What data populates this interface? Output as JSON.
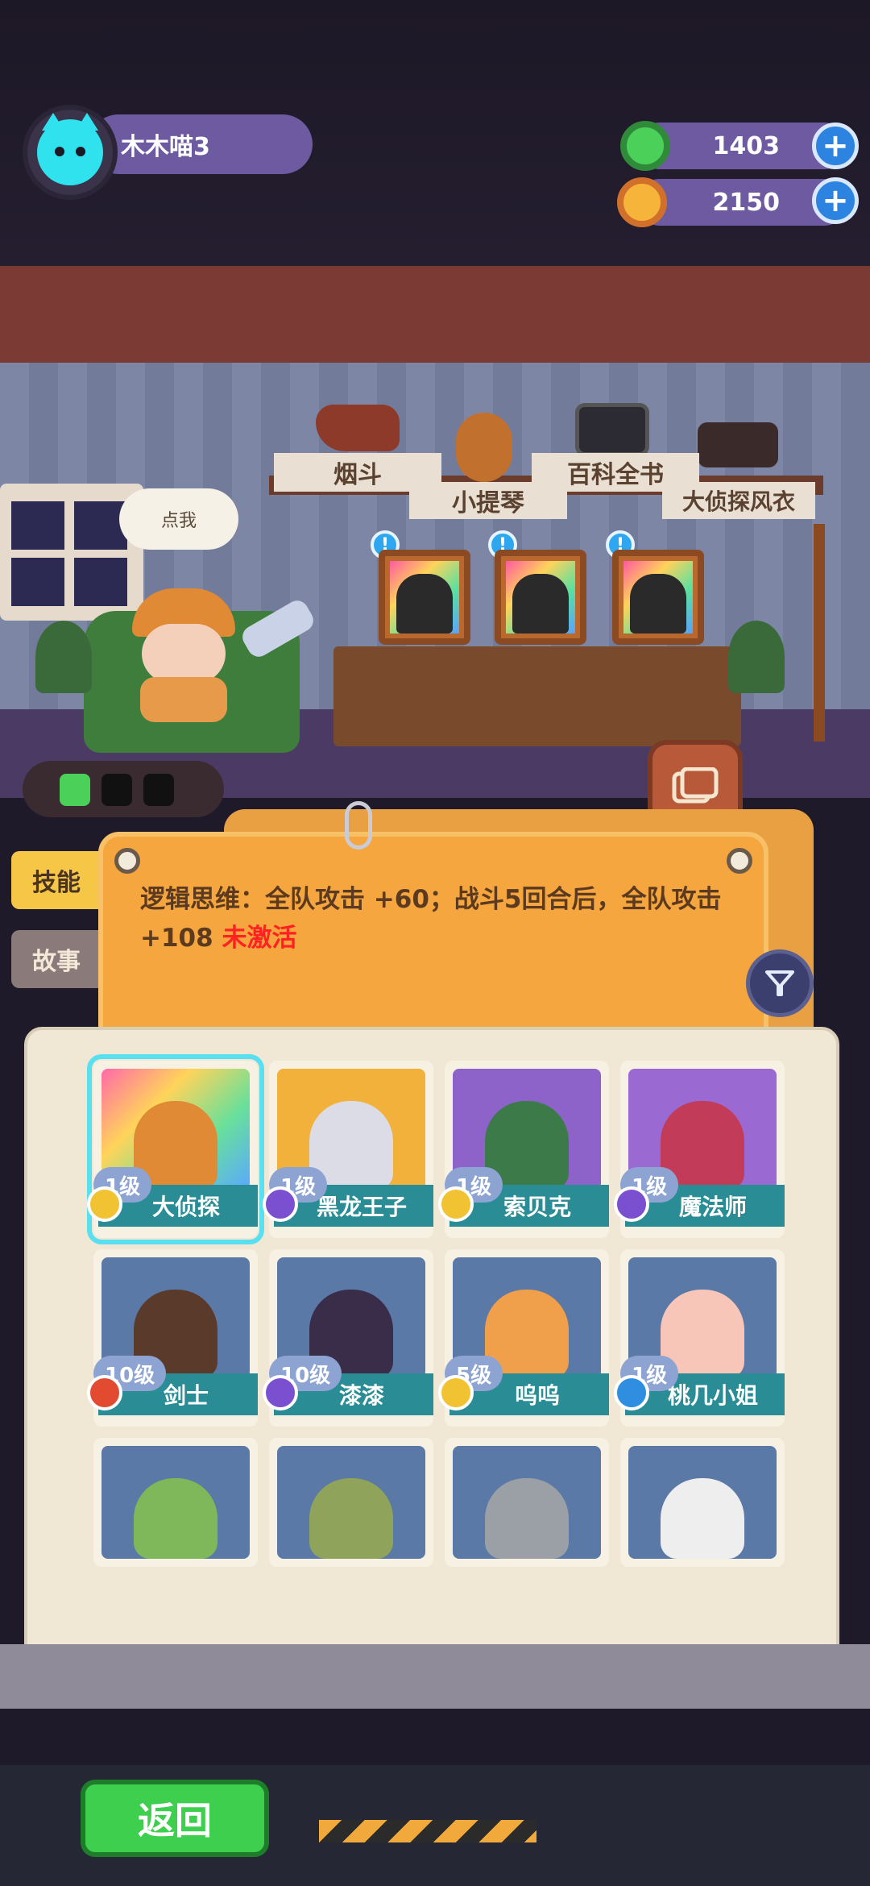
{
  "player": {
    "name": "木木喵3"
  },
  "resources": [
    {
      "icon": "donut-icon",
      "value": "1403",
      "color": "#4bd05a"
    },
    {
      "icon": "planet-coin-icon",
      "value": "2150",
      "color": "#f6b43a"
    }
  ],
  "scene": {
    "bubble": "点我",
    "relics": [
      "烟斗",
      "小提琴",
      "百科全书",
      "大侦探风衣"
    ]
  },
  "tabs": {
    "skill": "技能",
    "story": "故事"
  },
  "skill": {
    "text": "逻辑思维：全队攻击 +60；战斗5回合后，全队攻击 +108 ",
    "status": "未激活"
  },
  "characters": [
    {
      "level": "1级",
      "name": "大侦探",
      "badge_color": "#f1c232",
      "bg": "linear-gradient(135deg,#ff6aa8,#ffd45a,#69e09a,#5aa8ff)",
      "head": "#e08a35",
      "selected": true
    },
    {
      "level": "1级",
      "name": "黑龙王子",
      "badge_color": "#7a4fd0",
      "bg": "#f2b13a",
      "head": "#dcdce6",
      "selected": false
    },
    {
      "level": "1级",
      "name": "索贝克",
      "badge_color": "#f1c232",
      "bg": "#8d63c9",
      "head": "#3c7a4a",
      "selected": false
    },
    {
      "level": "1级",
      "name": "魔法师",
      "badge_color": "#7a4fd0",
      "bg": "#9a6ad2",
      "head": "#c23b58",
      "selected": false
    },
    {
      "level": "10级",
      "name": "剑士",
      "badge_color": "#e24b2f",
      "bg": "#5b79a6",
      "head": "#5a3a2a",
      "selected": false
    },
    {
      "level": "10级",
      "name": "漆漆",
      "badge_color": "#7a4fd0",
      "bg": "#5b79a6",
      "head": "#3a2d4a",
      "selected": false
    },
    {
      "level": "5级",
      "name": "呜呜",
      "badge_color": "#f1c232",
      "bg": "#5b79a6",
      "head": "#f0a04a",
      "selected": false
    },
    {
      "level": "1级",
      "name": "桃几小姐",
      "badge_color": "#2f8ee0",
      "bg": "#5b79a6",
      "head": "#f7c6b8",
      "selected": false
    },
    {
      "level": "",
      "name": "",
      "badge_color": "#888",
      "bg": "#5b79a6",
      "head": "#7fb85a",
      "selected": false
    },
    {
      "level": "",
      "name": "",
      "badge_color": "#888",
      "bg": "#5b79a6",
      "head": "#8fa35a",
      "selected": false
    },
    {
      "level": "",
      "name": "",
      "badge_color": "#888",
      "bg": "#5b79a6",
      "head": "#9aa0a6",
      "selected": false
    },
    {
      "level": "",
      "name": "",
      "badge_color": "#888",
      "bg": "#5b79a6",
      "head": "#eeeeee",
      "selected": false
    }
  ],
  "buttons": {
    "back": "返回"
  }
}
